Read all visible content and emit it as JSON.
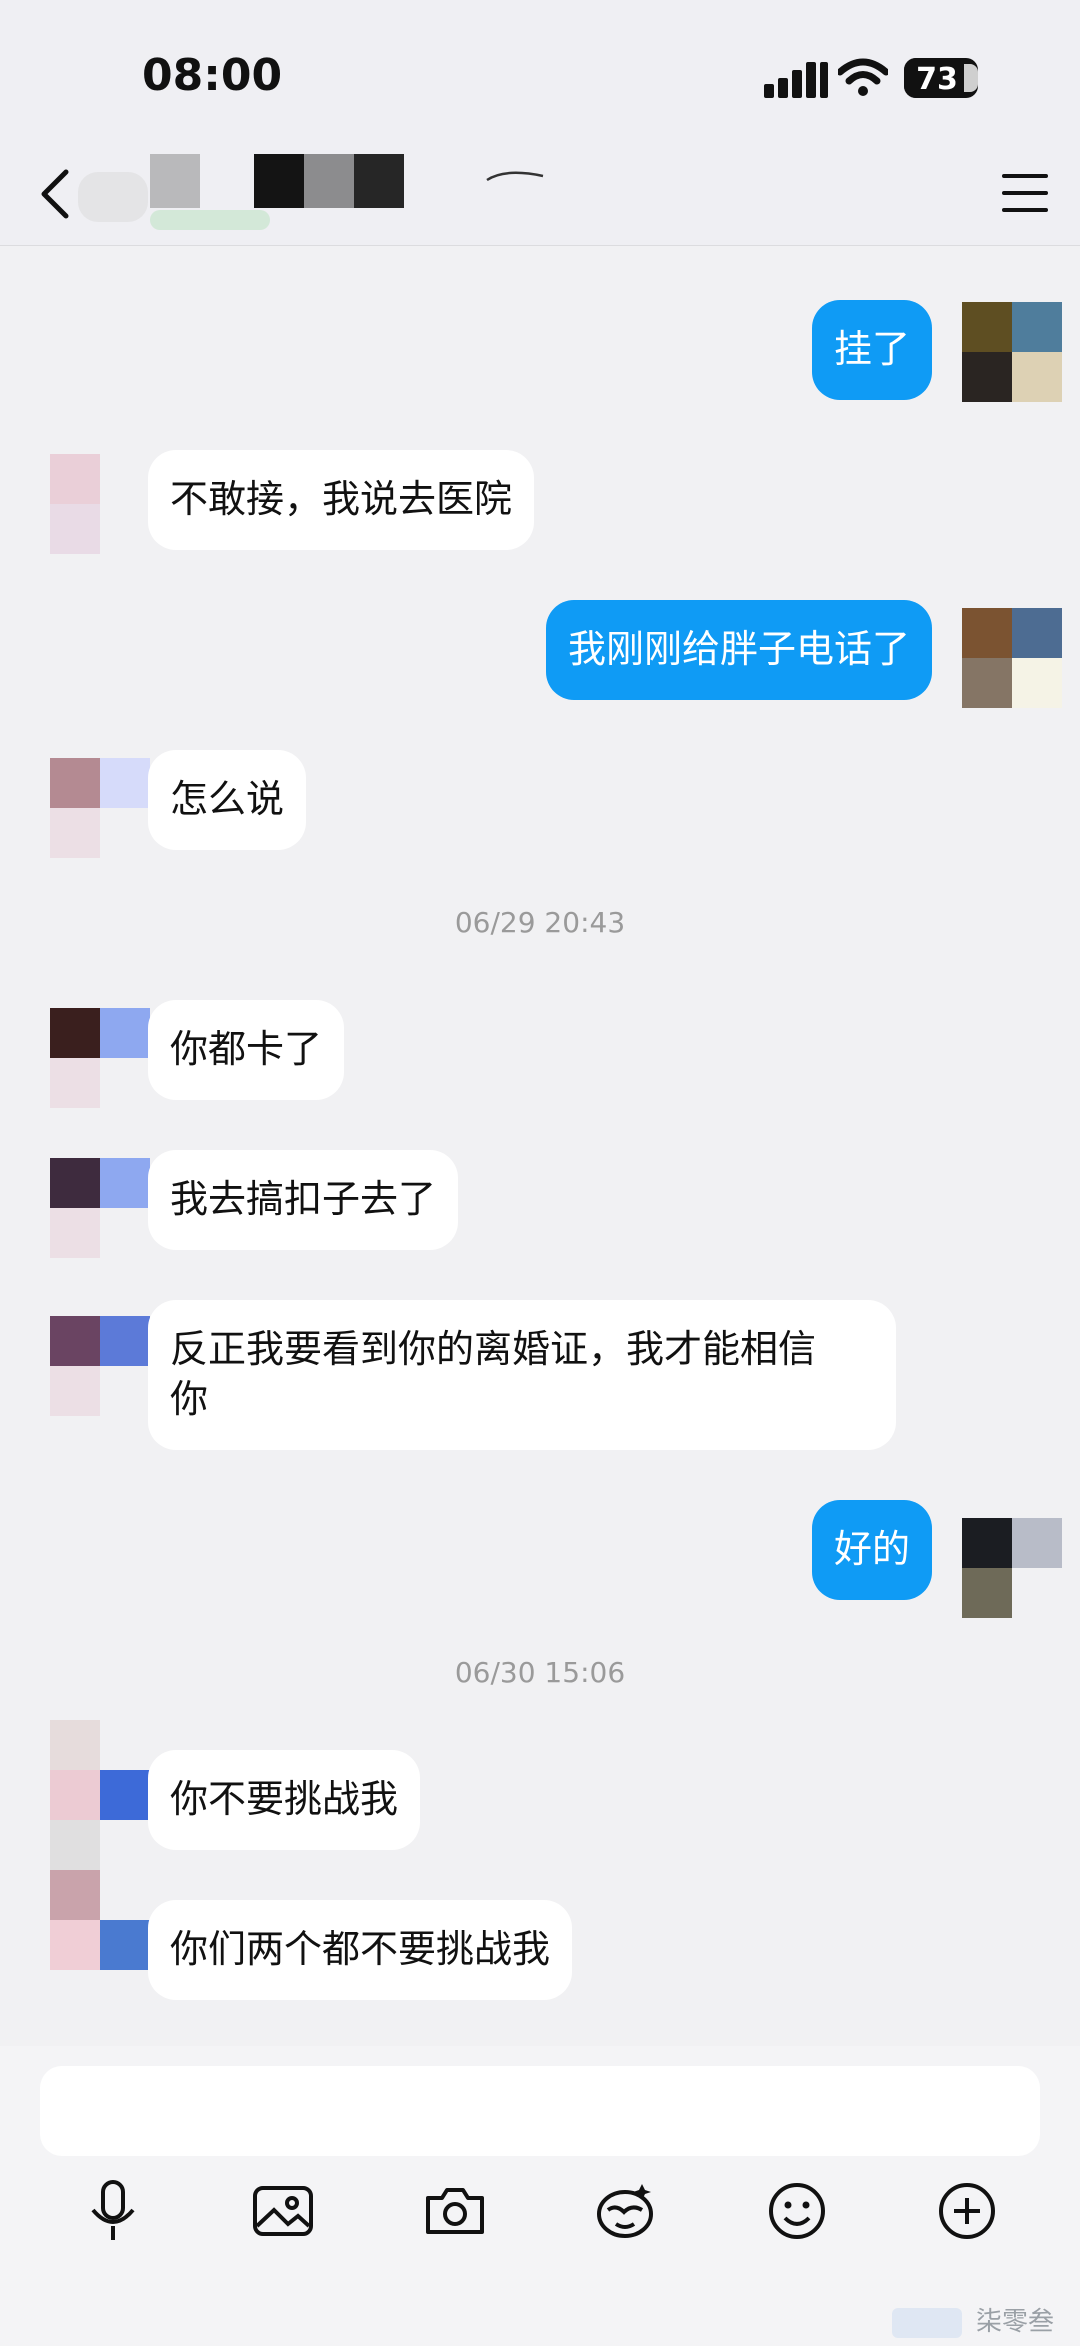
{
  "status": {
    "time": "08:00",
    "battery": "73"
  },
  "header": {
    "menu_icon": "hamburger-icon",
    "back_icon": "chevron-left-icon"
  },
  "messages": [
    {
      "side": "out",
      "text": "挂了"
    },
    {
      "side": "in",
      "text": "不敢接，我说去医院"
    },
    {
      "side": "out",
      "text": "我刚刚给胖子电话了"
    },
    {
      "side": "in",
      "text": "怎么说"
    },
    {
      "timestamp": "06/29 20:43"
    },
    {
      "side": "in",
      "text": "你都卡了"
    },
    {
      "side": "in",
      "text": "我去搞扣子去了"
    },
    {
      "side": "in",
      "text": "反正我要看到你的离婚证，我才能相信\n你"
    },
    {
      "side": "out",
      "text": "好的"
    },
    {
      "timestamp": "06/30 15:06"
    },
    {
      "side": "in",
      "text": "你不要挑战我"
    },
    {
      "side": "in",
      "text": "你们两个都不要挑战我"
    }
  ],
  "toolbar": {
    "icons": [
      "microphone-icon",
      "image-icon",
      "camera-icon",
      "sticker-icon",
      "emoji-icon",
      "plus-icon"
    ]
  },
  "watermark": "柒零叁"
}
